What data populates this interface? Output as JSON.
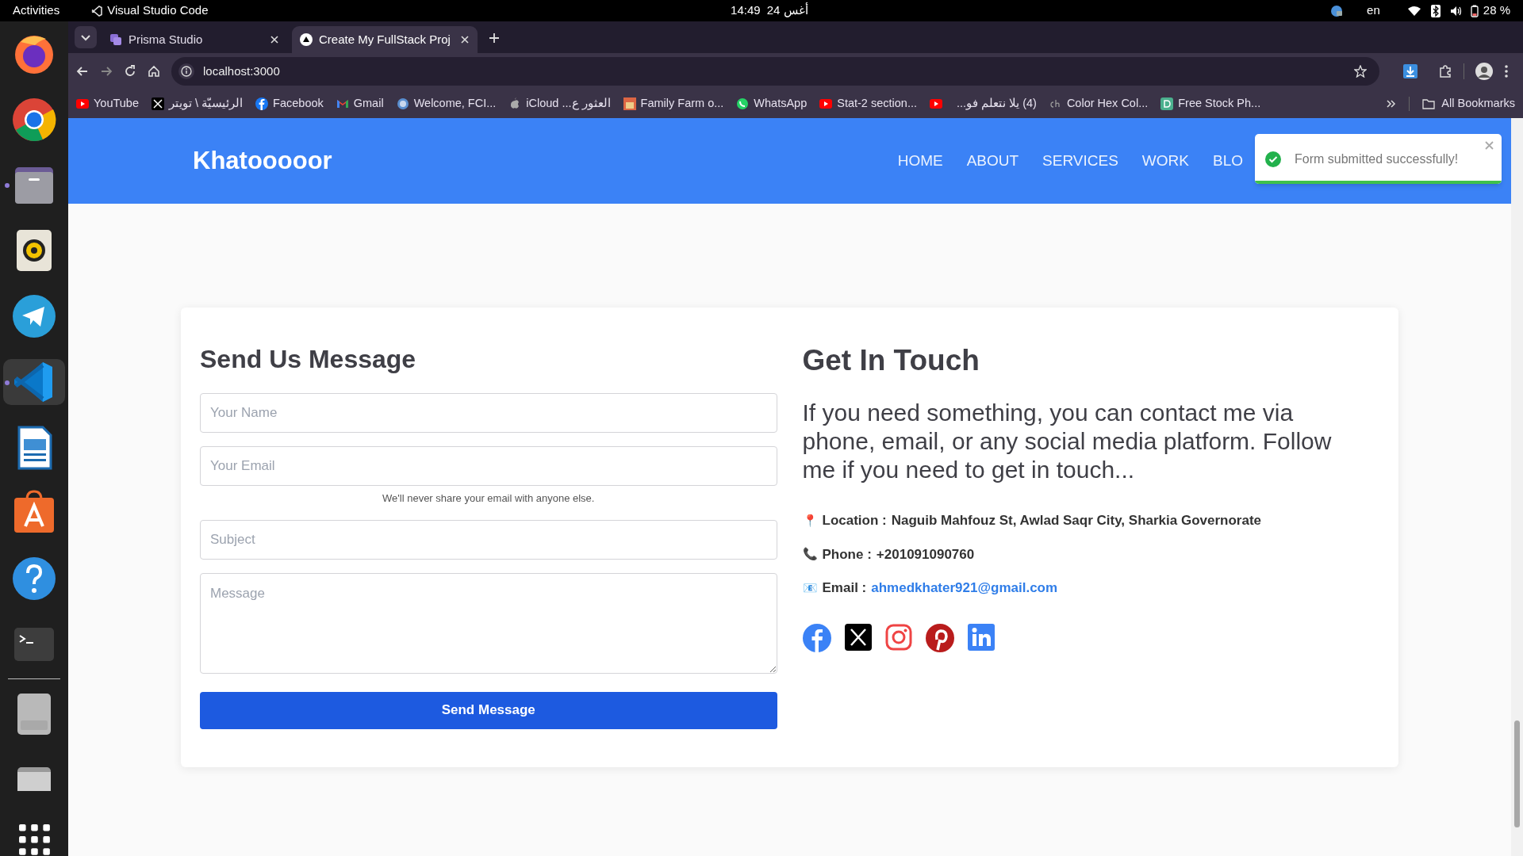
{
  "top_bar": {
    "activities": "Activities",
    "app_name": "Visual Studio Code",
    "time": "14:49",
    "date": "24 أغس",
    "language": "en",
    "battery": "28 %"
  },
  "dock": [
    {
      "running": false,
      "selected": false
    },
    {
      "running": false,
      "selected": false
    },
    {
      "running": true,
      "selected": false
    },
    {
      "running": false,
      "selected": false
    },
    {
      "running": false,
      "selected": false
    },
    {
      "running": true,
      "selected": true
    },
    {
      "running": false,
      "selected": false
    },
    {
      "running": false,
      "selected": false
    },
    {
      "running": false,
      "selected": false
    },
    {
      "running": false,
      "selected": false
    },
    {
      "running": false,
      "selected": false
    },
    {
      "running": false,
      "selected": false
    }
  ],
  "tabs": [
    {
      "title": "Prisma Studio",
      "selected": false
    },
    {
      "title": "Create My FullStack Proj",
      "selected": true
    }
  ],
  "address_bar": {
    "url": "localhost:3000"
  },
  "bookmarks": [
    {
      "label": "YouTube"
    },
    {
      "label": "الرئيسيّة \\ تويتر"
    },
    {
      "label": "Facebook"
    },
    {
      "label": "Gmail"
    },
    {
      "label": "Welcome, FCI..."
    },
    {
      "label": "العثور ع... iCloud"
    },
    {
      "label": "Family Farm o..."
    },
    {
      "label": "WhatsApp"
    },
    {
      "label": "Stat-2 section..."
    },
    {
      "label": "(4) يلا نتعلم فو..."
    },
    {
      "label": "Color Hex Col..."
    },
    {
      "label": "Free Stock Ph..."
    }
  ],
  "all_bookmarks": "All Bookmarks",
  "site": {
    "brand": "Khatooooor",
    "nav": [
      {
        "label": "HOME"
      },
      {
        "label": "ABOUT"
      },
      {
        "label": "SERVICES"
      },
      {
        "label": "WORK"
      },
      {
        "label": "BLO"
      }
    ]
  },
  "toast": {
    "message": "Form submitted successfully!",
    "level": 1
  },
  "form": {
    "title": "Send Us Message",
    "name": {
      "placeholder": "Your Name"
    },
    "email": {
      "placeholder": "Your Email"
    },
    "email_hint": "We'll never share your email with anyone else.",
    "subject": {
      "placeholder": "Subject"
    },
    "message": {
      "placeholder": "Message"
    },
    "submit": "Send Message"
  },
  "contact": {
    "title": "Get In Touch",
    "intro": "If you need something, you can contact me via phone, email, or any social media platform. Follow me if you need to get in touch...",
    "details": [
      {
        "kind": "location",
        "icon": "📍",
        "label": "Location :",
        "value": "Naguib Mahfouz St, Awlad Saqr City, Sharkia Governorate"
      },
      {
        "kind": "phone",
        "icon": "📞",
        "label": "Phone :",
        "value": "+201091090760"
      },
      {
        "kind": "email",
        "icon": "📧",
        "label": "Email :",
        "value": "ahmedkhater921@gmail.com"
      }
    ]
  }
}
